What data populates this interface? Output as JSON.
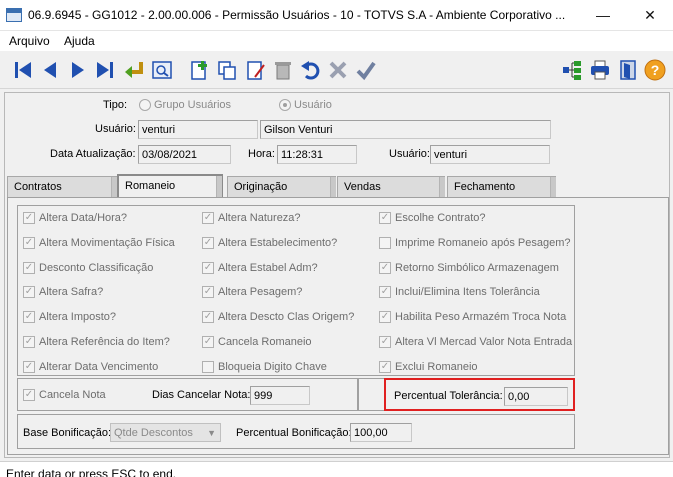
{
  "window": {
    "title": "06.9.6945 - GG1012 - 2.00.00.006 - Permissão Usuários - 10 - TOTVS S.A - Ambiente Corporativo ...",
    "minimize": "—",
    "close": "✕"
  },
  "menu": {
    "items": [
      "Arquivo",
      "Ajuda"
    ]
  },
  "header": {
    "tipo_label": "Tipo:",
    "tipo_options": [
      "Grupo Usuários",
      "Usuário"
    ],
    "tipo_selected": "Usuário",
    "usuario_label": "Usuário:",
    "usuario_code": "venturi",
    "usuario_name": "Gilson Venturi",
    "data_label": "Data Atualização:",
    "data_value": "03/08/2021",
    "hora_label": "Hora:",
    "hora_value": "11:28:31",
    "usuario2_label": "Usuário:",
    "usuario2_value": "venturi"
  },
  "tabs": [
    "Contratos",
    "Romaneio",
    "Originação",
    "Vendas",
    "Fechamento"
  ],
  "active_tab": "Romaneio",
  "checks": {
    "col1": [
      "Altera Data/Hora?",
      "Altera Movimentação Física",
      "Desconto Classificação",
      "Altera Safra?",
      "Altera Imposto?",
      "Altera Referência do Item?",
      "Alterar Data Vencimento"
    ],
    "col2": [
      "Altera Natureza?",
      "Altera Estabelecimento?",
      "Altera Estabel Adm?",
      "Altera Pesagem?",
      "Altera Descto Clas Origem?",
      "Cancela Romaneio",
      "Bloqueia Digito Chave"
    ],
    "col3": [
      "Escolhe Contrato?",
      "Imprime Romaneio após Pesagem?",
      "Retorno Simbólico Armazenagem",
      "Inclui/Elimina Itens Tolerância",
      "Habilita Peso Armazém Troca Nota",
      "Altera Vl Mercad Valor Nota Entrada",
      "Exclui Romaneio"
    ],
    "col1_checked": [
      true,
      true,
      true,
      true,
      true,
      true,
      true
    ],
    "col2_checked": [
      true,
      true,
      true,
      true,
      true,
      true,
      false
    ],
    "col3_checked": [
      true,
      false,
      true,
      true,
      true,
      true,
      true
    ]
  },
  "cancel": {
    "cancela_nota_label": "Cancela Nota",
    "dias_label": "Dias Cancelar Nota:",
    "dias_value": "999",
    "tolerancia_label": "Percentual Tolerância:",
    "tolerancia_value": "0,00"
  },
  "bonificacao": {
    "base_label": "Base Bonificação:",
    "base_value": "Qtde Descontos",
    "percentual_label": "Percentual Bonificação:",
    "percentual_value": "100,00"
  },
  "status": {
    "text": "Enter data or press ESC to end."
  },
  "colors": {
    "highlight": "#e02020",
    "toolbar_blue": "#2050b0"
  }
}
